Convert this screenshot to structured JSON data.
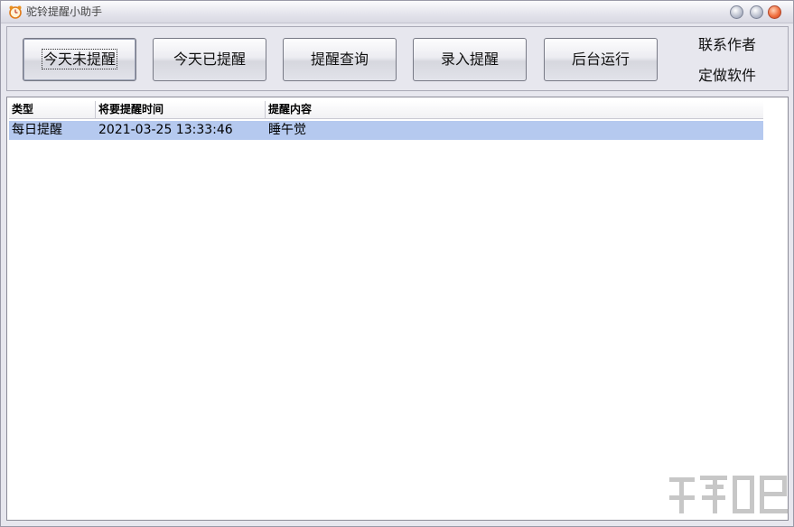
{
  "window": {
    "title": "驼铃提醒小助手"
  },
  "toolbar": {
    "buttons": [
      {
        "label": "今天未提醒"
      },
      {
        "label": "今天已提醒"
      },
      {
        "label": "提醒查询"
      },
      {
        "label": "录入提醒"
      },
      {
        "label": "后台运行"
      }
    ],
    "links": [
      {
        "label": "联系作者"
      },
      {
        "label": "定做软件"
      }
    ]
  },
  "table": {
    "columns": [
      "类型",
      "将要提醒时间",
      "提醒内容"
    ],
    "rows": [
      {
        "type": "每日提醒",
        "time": "2021-03-25 13:33:46",
        "content": "睡午觉"
      }
    ]
  },
  "colors": {
    "selection": "#b5c9ef",
    "close_button": "#f07040"
  },
  "icons": {
    "app": "alarm-clock-icon",
    "minimize": "minimize-icon",
    "maximize": "maximize-icon",
    "close": "close-icon"
  }
}
